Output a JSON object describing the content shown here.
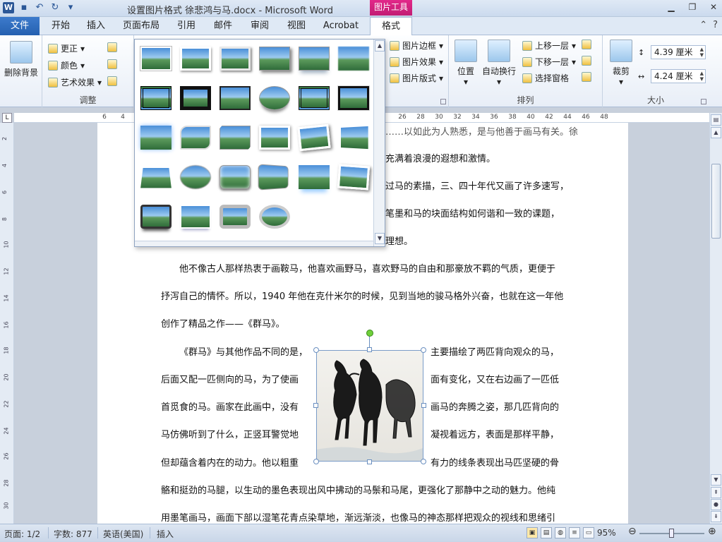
{
  "title": {
    "doc": "设置图片格式 徐悲鸿与马.docx",
    "app": "Microsoft Word",
    "context_tools": "图片工具"
  },
  "tabs": {
    "file": "文件",
    "items": [
      "开始",
      "插入",
      "页面布局",
      "引用",
      "邮件",
      "审阅",
      "视图",
      "Acrobat"
    ],
    "format": "格式"
  },
  "ribbon": {
    "remove_bg": "删除背景",
    "adjust": {
      "correct": "更正",
      "color": "颜色",
      "art_effects": "艺术效果",
      "label": "调整"
    },
    "styles": {
      "border": "图片边框",
      "effects": "图片效果",
      "layout": "图片版式"
    },
    "arrange": {
      "position": "位置",
      "wrap": "自动换行",
      "forward": "上移一层",
      "backward": "下移一层",
      "selection_pane": "选择窗格",
      "label": "排列"
    },
    "size": {
      "crop": "裁剪",
      "height": "4.39 厘米",
      "width": "4.24 厘米",
      "label": "大小"
    }
  },
  "ruler_h": [
    "6",
    "4",
    "2",
    "26",
    "28",
    "30",
    "32",
    "34",
    "36",
    "38",
    "40",
    "42",
    "44",
    "46",
    "48"
  ],
  "ruler_v": [
    "2",
    "4",
    "6",
    "8",
    "10",
    "12",
    "14",
    "16",
    "18",
    "20",
    "22",
    "24",
    "26",
    "28",
    "30"
  ],
  "doc": {
    "top_frag": "……以如此为人熟悉，是与他善于画马有关。徐",
    "frag_lines": [
      "充满着浪漫的遐想和激情。",
      "过马的素描，三、四十年代又画了许多速写，",
      "笔墨和马的块面结构如何谐和一致的课题，",
      "理想。"
    ],
    "para1": [
      "他不像古人那样热衷于画鞍马，他喜欢画野马，喜欢野马的自由和那豪放不羁的气质，更便于",
      "抒泻自己的情怀。所以，1940 年他在克什米尔的时候，见到当地的骏马格外兴奋，也就在这一年他",
      "创作了精品之作——《群马》。"
    ],
    "para2_left": [
      "《群马》与其他作品不同的是，",
      "后面又配一匹侧向的马，为了使画",
      "首觅食的马。画家在此画中，没有",
      "马仿佛听到了什么，正竖耳警觉地",
      "但却蕴含着内在的动力。他以粗重"
    ],
    "para2_right": [
      "主要描绘了两匹背向观众的马，",
      "面有变化，又在右边画了一匹低",
      "画马的奔腾之姿，那几匹背向的",
      "凝视着远方，表面是那样平静，",
      "有力的线条表现出马匹坚硬的骨"
    ],
    "para2_cont": [
      "骼和挺劲的马腿，以生动的墨色表现出风中拂动的马鬃和马尾，更强化了那静中之动的魅力。他纯",
      "用墨笔画马，画面下部以湿笔花青点染草地，渐远渐淡，也像马的神态那样把观众的视线和思绪引"
    ]
  },
  "status": {
    "page": "页面: 1/2",
    "words": "字数: 877",
    "lang": "英语(美国)",
    "mode": "插入",
    "zoom": "95%"
  }
}
